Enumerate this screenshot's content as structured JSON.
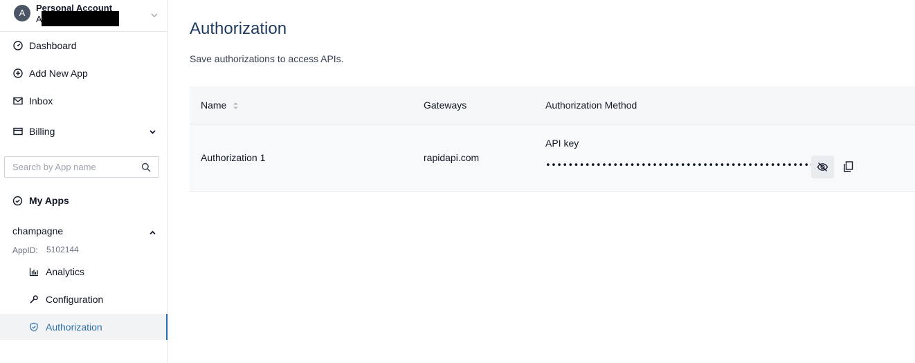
{
  "account": {
    "avatar_letter": "A",
    "name": "Personal Account",
    "sub": "A"
  },
  "sidebar": {
    "items": [
      {
        "label": "Dashboard",
        "icon": "dashboard-icon"
      },
      {
        "label": "Add New App",
        "icon": "plus-circle-icon"
      },
      {
        "label": "Inbox",
        "icon": "mail-icon"
      },
      {
        "label": "Billing",
        "icon": "billing-icon"
      }
    ],
    "search_placeholder": "Search by App name",
    "my_apps_label": "My Apps",
    "app": {
      "name": "champagne",
      "appid_label": "AppID:",
      "appid_value": "5102144",
      "sub_items": [
        {
          "label": "Analytics",
          "icon": "bar-chart-icon"
        },
        {
          "label": "Configuration",
          "icon": "wrench-icon"
        },
        {
          "label": "Authorization",
          "icon": "shield-icon",
          "active": true
        }
      ]
    }
  },
  "main": {
    "title": "Authorization",
    "subtitle": "Save authorizations to access APIs.",
    "table": {
      "columns": [
        "Name",
        "Gateways",
        "Authorization Method"
      ],
      "rows": [
        {
          "name": "Authorization 1",
          "gateway": "rapidapi.com",
          "method_label": "API key",
          "masked_key": "••••••••••••••••••••••••••••••••••••••••••••••••••"
        }
      ]
    }
  },
  "colors": {
    "accent": "#2f6fa8",
    "title": "#1e3a5f",
    "header_bg": "#f6f7f8"
  }
}
